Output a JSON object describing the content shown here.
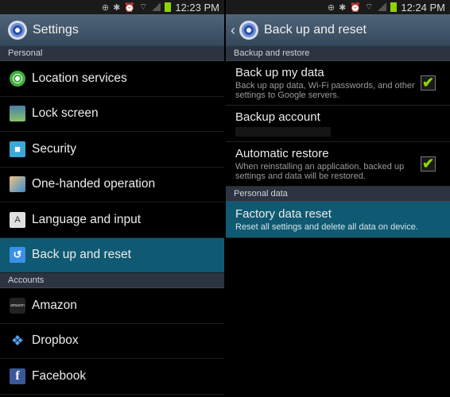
{
  "left": {
    "status": {
      "time": "12:23 PM"
    },
    "title": "Settings",
    "sections": [
      {
        "label": "Personal"
      },
      {
        "label": "Accounts"
      }
    ],
    "personal_items": [
      {
        "label": "Location services",
        "icon": "location-icon"
      },
      {
        "label": "Lock screen",
        "icon": "lock-screen-icon"
      },
      {
        "label": "Security",
        "icon": "security-lock-icon"
      },
      {
        "label": "One-handed operation",
        "icon": "one-handed-icon"
      },
      {
        "label": "Language and input",
        "icon": "language-icon"
      },
      {
        "label": "Back up and reset",
        "icon": "backup-icon",
        "selected": true
      }
    ],
    "account_items": [
      {
        "label": "Amazon",
        "icon": "amazon-icon"
      },
      {
        "label": "Dropbox",
        "icon": "dropbox-icon"
      },
      {
        "label": "Facebook",
        "icon": "facebook-icon"
      }
    ]
  },
  "right": {
    "status": {
      "time": "12:24 PM"
    },
    "title": "Back up and reset",
    "sections": [
      {
        "label": "Backup and restore"
      },
      {
        "label": "Personal data"
      }
    ],
    "items": [
      {
        "title": "Back up my data",
        "sub": "Back up app data, Wi-Fi passwords, and other settings to Google servers.",
        "checked": true
      },
      {
        "title": "Backup account",
        "sub": ""
      },
      {
        "title": "Automatic restore",
        "sub": "When reinstalling an application, backed up settings and data will be restored.",
        "checked": true
      },
      {
        "title": "Factory data reset",
        "sub": "Reset all settings and delete all data on device.",
        "selected": true
      }
    ]
  },
  "icons": {
    "check": "✔",
    "chevron": "‹",
    "lang": "A",
    "backup": "↺",
    "fb": "f",
    "dropbox": "❖",
    "amazon": "amazon",
    "lock": "🔒"
  }
}
